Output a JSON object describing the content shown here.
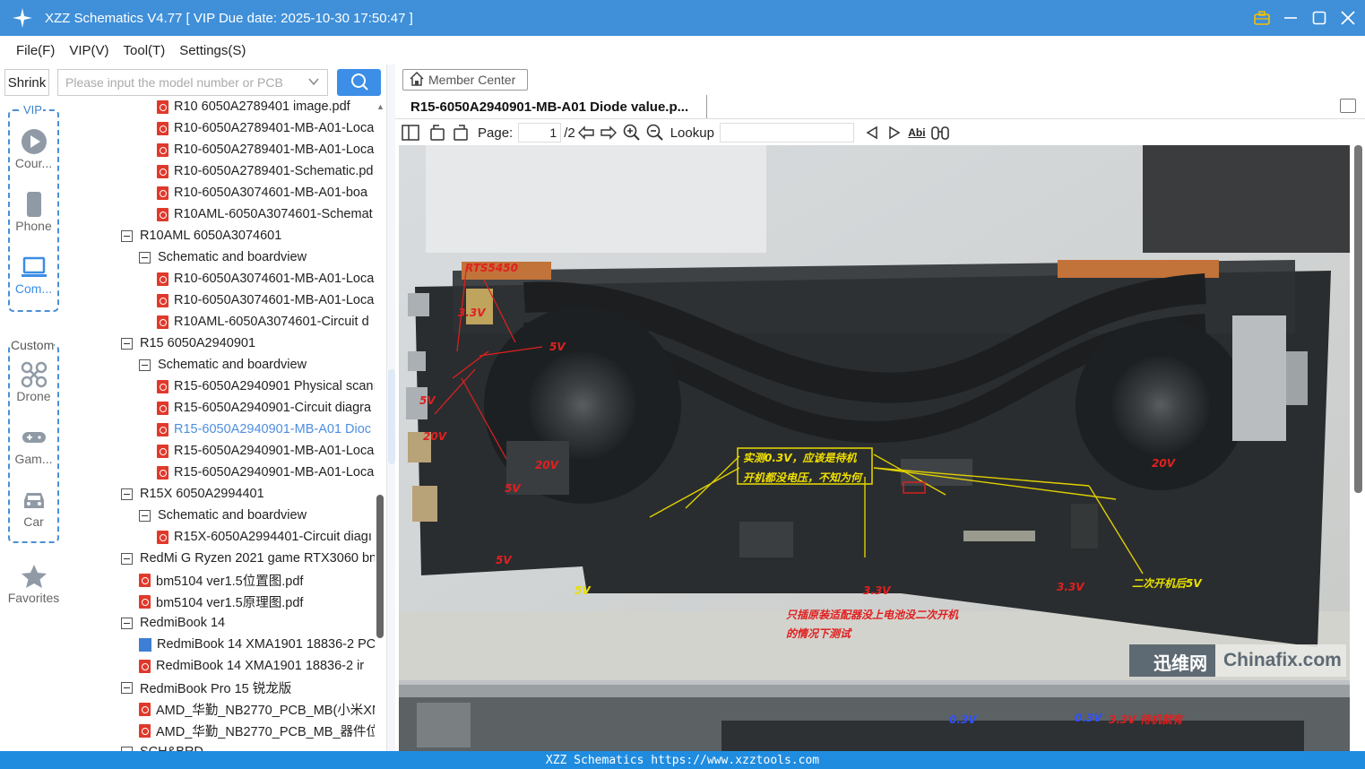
{
  "titlebar": {
    "title": "XZZ Schematics V4.77 [ VIP Due date: 2025-10-30 17:50:47 ]",
    "bg_color": "#3f8fd9"
  },
  "menu": [
    "File(F)",
    "VIP(V)",
    "Tool(T)",
    "Settings(S)"
  ],
  "sidebar": {
    "shrink_label": "Shrink",
    "vip_label": "VIP",
    "custom_label": "Custom",
    "vip_items": [
      {
        "label": "Cour...",
        "icon": "play-icon"
      },
      {
        "label": "Phone",
        "icon": "phone-icon"
      },
      {
        "label": "Com...",
        "icon": "laptop-icon"
      }
    ],
    "custom_items": [
      {
        "label": "Drone",
        "icon": "drone-icon"
      },
      {
        "label": "Gam...",
        "icon": "gamepad-icon"
      },
      {
        "label": "Car",
        "icon": "car-icon"
      }
    ],
    "favorites_label": "Favorites"
  },
  "search": {
    "placeholder": "Please input the model number or PCB"
  },
  "tree": [
    {
      "label": "R10 6050A2789401 image.pdf",
      "type": "pdf",
      "level": 2
    },
    {
      "label": "R10-6050A2789401-MB-A01-Loca",
      "type": "pdf",
      "level": 2
    },
    {
      "label": "R10-6050A2789401-MB-A01-Loca",
      "type": "pdf",
      "level": 2
    },
    {
      "label": "R10-6050A2789401-Schematic.pd",
      "type": "pdf",
      "level": 2
    },
    {
      "label": "R10-6050A3074601-MB-A01-boa",
      "type": "pdf",
      "level": 2
    },
    {
      "label": "R10AML-6050A3074601-Schemat",
      "type": "pdf",
      "level": 2
    },
    {
      "label": "R10AML 6050A3074601",
      "type": "folder",
      "level": 0
    },
    {
      "label": "Schematic and boardview",
      "type": "folder",
      "level": 1
    },
    {
      "label": "R10-6050A3074601-MB-A01-Loca",
      "type": "pdf",
      "level": 2
    },
    {
      "label": "R10-6050A3074601-MB-A01-Loca",
      "type": "pdf",
      "level": 2
    },
    {
      "label": "R10AML-6050A3074601-Circuit d",
      "type": "pdf",
      "level": 2
    },
    {
      "label": "R15 6050A2940901",
      "type": "folder",
      "level": 0
    },
    {
      "label": "Schematic and boardview",
      "type": "folder",
      "level": 1
    },
    {
      "label": "R15-6050A2940901 Physical scanı",
      "type": "pdf",
      "level": 2
    },
    {
      "label": "R15-6050A2940901-Circuit diagra",
      "type": "pdf",
      "level": 2
    },
    {
      "label": "R15-6050A2940901-MB-A01 Dioc",
      "type": "pdf",
      "level": 2,
      "selected": true
    },
    {
      "label": "R15-6050A2940901-MB-A01-Loca",
      "type": "pdf",
      "level": 2
    },
    {
      "label": "R15-6050A2940901-MB-A01-Loca",
      "type": "pdf",
      "level": 2
    },
    {
      "label": "R15X 6050A2994401",
      "type": "folder",
      "level": 0
    },
    {
      "label": "Schematic and boardview",
      "type": "folder",
      "level": 1
    },
    {
      "label": "R15X-6050A2994401-Circuit diagı",
      "type": "pdf",
      "level": 2
    },
    {
      "label": "RedMi G Ryzen 2021 game RTX3060 bn",
      "type": "folder",
      "level": 0
    },
    {
      "label": "bm5104 ver1.5位置图.pdf",
      "type": "pdf",
      "level": 1
    },
    {
      "label": "bm5104 ver1.5原理图.pdf",
      "type": "pdf",
      "level": 1
    },
    {
      "label": "RedmiBook 14",
      "type": "folder",
      "level": 0
    },
    {
      "label": "RedmiBook 14 XMA1901 18836-2 PC",
      "type": "boardview",
      "level": 1
    },
    {
      "label": "RedmiBook 14 XMA1901 18836-2 ir",
      "type": "pdf",
      "level": 1
    },
    {
      "label": "RedmiBook Pro 15 锐龙版",
      "type": "folder",
      "level": 0
    },
    {
      "label": "AMD_华勤_NB2770_PCB_MB(小米XM",
      "type": "pdf",
      "level": 1
    },
    {
      "label": "AMD_华勤_NB2770_PCB_MB_器件位号",
      "type": "pdf",
      "level": 1
    },
    {
      "label": "SCH&BRD",
      "type": "folder",
      "level": 0
    }
  ],
  "right": {
    "member_center": "Member Center",
    "doc_tab": "R15-6050A2940901-MB-A01 Diode value.p...",
    "page_label": "Page:",
    "page_current": "1",
    "page_total": "/2",
    "lookup_label": "Lookup",
    "lookup_value": ""
  },
  "photo": {
    "labels": [
      {
        "text": "RTS5450",
        "color": "#e02020"
      },
      {
        "text": "3.3V",
        "color": "#e02020"
      },
      {
        "text": "5V",
        "color": "#e02020"
      },
      {
        "text": "5V",
        "color": "#e02020"
      },
      {
        "text": "20V",
        "color": "#e02020"
      },
      {
        "text": "20V",
        "color": "#e02020"
      },
      {
        "text": "5V",
        "color": "#e02020"
      },
      {
        "text": "5V",
        "color": "#e02020"
      },
      {
        "text": "5V",
        "color": "#e8e000"
      },
      {
        "text": "实测0.3V，应该是待机",
        "color": "#f0e000"
      },
      {
        "text": "开机都没电压，不知为何",
        "color": "#f0e000"
      },
      {
        "text": "20V",
        "color": "#e02020"
      },
      {
        "text": "3.3V",
        "color": "#e02020"
      },
      {
        "text": "3.3V",
        "color": "#e02020"
      },
      {
        "text": "二次开机后5V",
        "color": "#e8e000"
      },
      {
        "text": "只插原装适配器没上电池没二次开机",
        "color": "#e02020"
      },
      {
        "text": "的情况下测试",
        "color": "#e02020"
      },
      {
        "text": "0.3V",
        "color": "#3050ff"
      },
      {
        "text": "0.3V",
        "color": "#3050ff"
      },
      {
        "text": "3.3V 待机就有",
        "color": "#e02020"
      }
    ],
    "watermark_cn": "迅维网",
    "watermark_en": "Chinafix.com"
  },
  "statusbar": {
    "text": "XZZ Schematics https://www.xzztools.com"
  }
}
